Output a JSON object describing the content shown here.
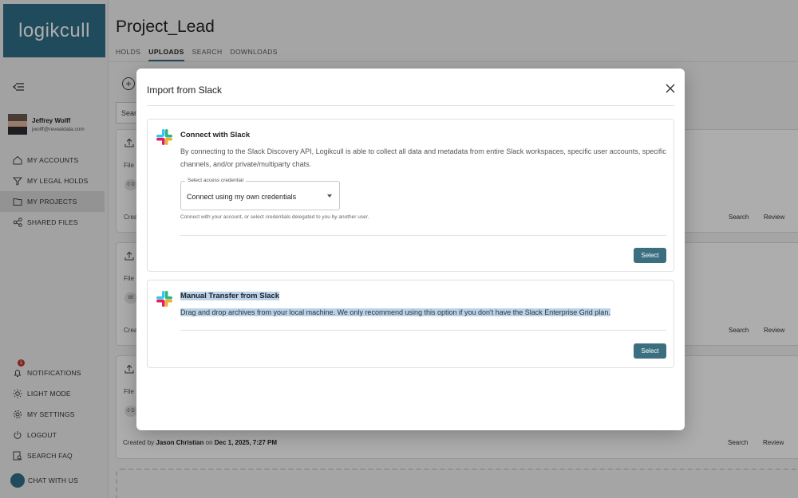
{
  "brand": {
    "logo_text": "logikcull"
  },
  "user": {
    "name": "Jeffrey Wolff",
    "email": "jwolff@revealdata.com"
  },
  "sidebar": {
    "items": [
      {
        "label": "MY ACCOUNTS",
        "icon": "home-icon"
      },
      {
        "label": "MY LEGAL HOLDS",
        "icon": "funnel-icon"
      },
      {
        "label": "MY PROJECTS",
        "icon": "folder-icon",
        "active": true
      },
      {
        "label": "SHARED FILES",
        "icon": "share-icon"
      }
    ],
    "bottom_items": [
      {
        "label": "NOTIFICATIONS",
        "icon": "bell-icon",
        "badge": "1"
      },
      {
        "label": "LIGHT MODE",
        "icon": "sun-icon"
      },
      {
        "label": "MY SETTINGS",
        "icon": "gear-icon"
      },
      {
        "label": "LOGOUT",
        "icon": "power-icon"
      },
      {
        "label": "SEARCH FAQ",
        "icon": "search-faq-icon"
      },
      {
        "label": "CHAT WITH US",
        "icon": "chat-icon"
      }
    ]
  },
  "project": {
    "title": "Project_Lead",
    "tabs": [
      "HOLDS",
      "UPLOADS",
      "SEARCH",
      "DOWNLOADS"
    ],
    "active_tab": "UPLOADS",
    "search_stub": "Sear"
  },
  "background_rows": {
    "file_label": "File",
    "pill_texts": [
      "0 D",
      "85",
      "0 D"
    ],
    "created_stub": "Creat",
    "action_search": "Search",
    "action_review": "Review",
    "last_created": {
      "prefix": "Created by",
      "user": "Jason Christian",
      "on": "on",
      "date": "Dec 1, 2025, 7:27 PM"
    }
  },
  "modal": {
    "title": "Import from Slack",
    "connect": {
      "title": "Connect with Slack",
      "description": "By connecting to the Slack Discovery API, Logikcull is able to collect all data and metadata from entire Slack workspaces, specific user accounts, specific channels, and/or private/multiparty chats.",
      "select_label": "Select access credential",
      "select_value": "Connect using my own credentials",
      "help_text": "Connect with your account, or select credentials delegated to you by another user.",
      "button": "Select"
    },
    "manual": {
      "title": "Manual Transfer from Slack",
      "description": "Drag and drop archives from your local machine. We only recommend using this option if you don't have the Slack Enterprise Grid plan.",
      "button": "Select"
    }
  },
  "colors": {
    "brand": "#2f6f89",
    "button": "#3b6f80",
    "highlight": "#b9d3ea"
  }
}
